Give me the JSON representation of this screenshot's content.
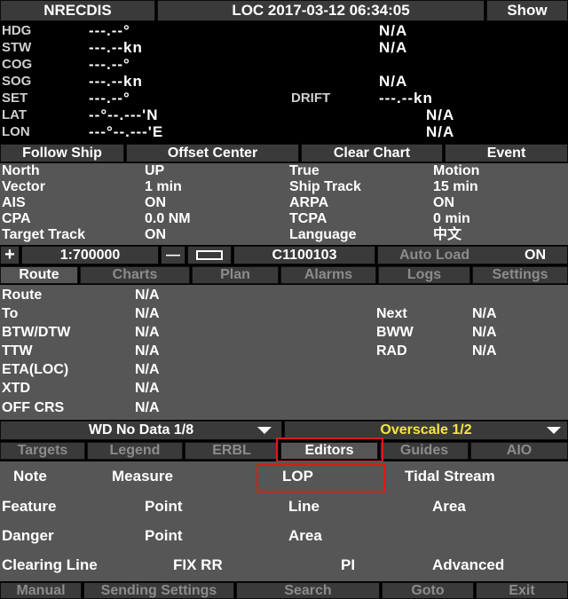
{
  "header": {
    "app": "NRECDIS",
    "loc": "LOC 2017-03-12 06:34:05",
    "show": "Show"
  },
  "nav": [
    {
      "label": "HDG",
      "value": "---.--°",
      "right": "N/A"
    },
    {
      "label": "STW",
      "value": "---.--kn",
      "right": "N/A"
    },
    {
      "label": "COG",
      "value": "---.--°",
      "right": ""
    },
    {
      "label": "SOG",
      "value": "---.--kn",
      "right": "N/A"
    },
    {
      "label": "SET",
      "value": "---.--°",
      "drift_label": "DRIFT",
      "drift_value": "---.--kn"
    },
    {
      "label": "LAT",
      "value": "--°--.---'N",
      "right": "N/A"
    },
    {
      "label": "LON",
      "value": "---°--.---'E",
      "right": "N/A"
    }
  ],
  "actions": {
    "follow_ship": "Follow Ship",
    "offset_center": "Offset Center",
    "clear_chart": "Clear Chart",
    "event": "Event"
  },
  "display": [
    {
      "l1": "North",
      "v1": "UP",
      "l2": "True",
      "v2": "Motion"
    },
    {
      "l1": "Vector",
      "v1": "1 min",
      "l2": "Ship Track",
      "v2": "15 min"
    },
    {
      "l1": "AIS",
      "v1": "ON",
      "l2": "ARPA",
      "v2": "ON"
    },
    {
      "l1": "CPA",
      "v1": "0.0 NM",
      "l2": "TCPA",
      "v2": "0 min"
    },
    {
      "l1": "Target Track",
      "v1": "ON",
      "l2": "Language",
      "v2": "中文"
    }
  ],
  "scale_bar": {
    "plus": "+",
    "scale": "1:700000",
    "minus": "—",
    "chart_id": "C1100103",
    "auto_load_label": "Auto Load",
    "auto_load_value": "ON"
  },
  "tabs1": [
    "Route",
    "Charts",
    "Plan",
    "Alarms",
    "Logs",
    "Settings"
  ],
  "route": {
    "rows": [
      {
        "l": "Route",
        "v": "N/A"
      },
      {
        "l": "To",
        "v": "N/A",
        "l2": "Next",
        "v2": "N/A"
      },
      {
        "l": "BTW/DTW",
        "v": "N/A",
        "l2": "BWW",
        "v2": "N/A"
      },
      {
        "l": "TTW",
        "v": "N/A",
        "l2": "RAD",
        "v2": "N/A"
      },
      {
        "l": "ETA(LOC)",
        "v": "N/A"
      },
      {
        "l": "XTD",
        "v": "N/A"
      },
      {
        "l": "OFF CRS",
        "v": "N/A"
      }
    ]
  },
  "status": {
    "wd": "WD No Data 1/8",
    "overscale": "Overscale 1/2",
    "overscale_color": "#f5e642"
  },
  "tabs2": [
    "Targets",
    "Legend",
    "ERBL",
    "Editors",
    "Guides",
    "AIO"
  ],
  "editors": {
    "row1": [
      "Note",
      "Measure",
      "LOP",
      "Tidal Stream"
    ],
    "feature": {
      "label": "Feature",
      "items": [
        "Point",
        "Line",
        "Area"
      ]
    },
    "danger": {
      "label": "Danger",
      "items": [
        "Point",
        "Area"
      ]
    },
    "row4": [
      "Clearing Line",
      "FIX RR",
      "PI",
      "Advanced"
    ]
  },
  "bottom": [
    "Manual",
    "Sending Settings",
    "Search",
    "Goto",
    "Exit"
  ],
  "colors": {
    "highlight_box": "#e01818",
    "panel": "#565656",
    "button": "#3a3a3a"
  }
}
